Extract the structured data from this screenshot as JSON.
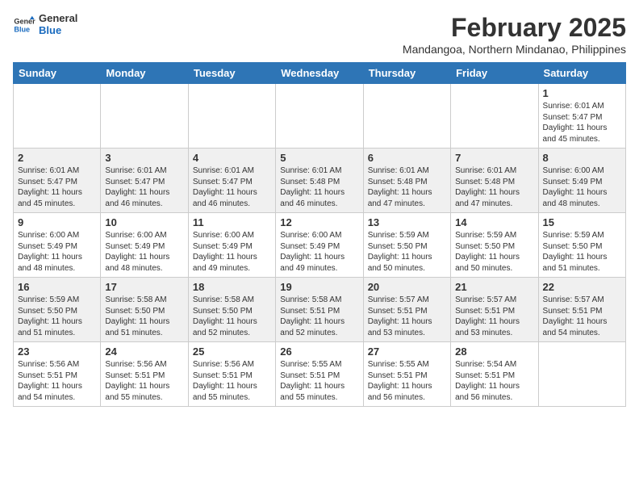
{
  "header": {
    "logo_line1": "General",
    "logo_line2": "Blue",
    "month_year": "February 2025",
    "location": "Mandangoa, Northern Mindanao, Philippines"
  },
  "days_of_week": [
    "Sunday",
    "Monday",
    "Tuesday",
    "Wednesday",
    "Thursday",
    "Friday",
    "Saturday"
  ],
  "weeks": [
    [
      {
        "day": "",
        "info": ""
      },
      {
        "day": "",
        "info": ""
      },
      {
        "day": "",
        "info": ""
      },
      {
        "day": "",
        "info": ""
      },
      {
        "day": "",
        "info": ""
      },
      {
        "day": "",
        "info": ""
      },
      {
        "day": "1",
        "info": "Sunrise: 6:01 AM\nSunset: 5:47 PM\nDaylight: 11 hours and 45 minutes."
      }
    ],
    [
      {
        "day": "2",
        "info": "Sunrise: 6:01 AM\nSunset: 5:47 PM\nDaylight: 11 hours and 45 minutes."
      },
      {
        "day": "3",
        "info": "Sunrise: 6:01 AM\nSunset: 5:47 PM\nDaylight: 11 hours and 46 minutes."
      },
      {
        "day": "4",
        "info": "Sunrise: 6:01 AM\nSunset: 5:47 PM\nDaylight: 11 hours and 46 minutes."
      },
      {
        "day": "5",
        "info": "Sunrise: 6:01 AM\nSunset: 5:48 PM\nDaylight: 11 hours and 46 minutes."
      },
      {
        "day": "6",
        "info": "Sunrise: 6:01 AM\nSunset: 5:48 PM\nDaylight: 11 hours and 47 minutes."
      },
      {
        "day": "7",
        "info": "Sunrise: 6:01 AM\nSunset: 5:48 PM\nDaylight: 11 hours and 47 minutes."
      },
      {
        "day": "8",
        "info": "Sunrise: 6:00 AM\nSunset: 5:49 PM\nDaylight: 11 hours and 48 minutes."
      }
    ],
    [
      {
        "day": "9",
        "info": "Sunrise: 6:00 AM\nSunset: 5:49 PM\nDaylight: 11 hours and 48 minutes."
      },
      {
        "day": "10",
        "info": "Sunrise: 6:00 AM\nSunset: 5:49 PM\nDaylight: 11 hours and 48 minutes."
      },
      {
        "day": "11",
        "info": "Sunrise: 6:00 AM\nSunset: 5:49 PM\nDaylight: 11 hours and 49 minutes."
      },
      {
        "day": "12",
        "info": "Sunrise: 6:00 AM\nSunset: 5:49 PM\nDaylight: 11 hours and 49 minutes."
      },
      {
        "day": "13",
        "info": "Sunrise: 5:59 AM\nSunset: 5:50 PM\nDaylight: 11 hours and 50 minutes."
      },
      {
        "day": "14",
        "info": "Sunrise: 5:59 AM\nSunset: 5:50 PM\nDaylight: 11 hours and 50 minutes."
      },
      {
        "day": "15",
        "info": "Sunrise: 5:59 AM\nSunset: 5:50 PM\nDaylight: 11 hours and 51 minutes."
      }
    ],
    [
      {
        "day": "16",
        "info": "Sunrise: 5:59 AM\nSunset: 5:50 PM\nDaylight: 11 hours and 51 minutes."
      },
      {
        "day": "17",
        "info": "Sunrise: 5:58 AM\nSunset: 5:50 PM\nDaylight: 11 hours and 51 minutes."
      },
      {
        "day": "18",
        "info": "Sunrise: 5:58 AM\nSunset: 5:50 PM\nDaylight: 11 hours and 52 minutes."
      },
      {
        "day": "19",
        "info": "Sunrise: 5:58 AM\nSunset: 5:51 PM\nDaylight: 11 hours and 52 minutes."
      },
      {
        "day": "20",
        "info": "Sunrise: 5:57 AM\nSunset: 5:51 PM\nDaylight: 11 hours and 53 minutes."
      },
      {
        "day": "21",
        "info": "Sunrise: 5:57 AM\nSunset: 5:51 PM\nDaylight: 11 hours and 53 minutes."
      },
      {
        "day": "22",
        "info": "Sunrise: 5:57 AM\nSunset: 5:51 PM\nDaylight: 11 hours and 54 minutes."
      }
    ],
    [
      {
        "day": "23",
        "info": "Sunrise: 5:56 AM\nSunset: 5:51 PM\nDaylight: 11 hours and 54 minutes."
      },
      {
        "day": "24",
        "info": "Sunrise: 5:56 AM\nSunset: 5:51 PM\nDaylight: 11 hours and 55 minutes."
      },
      {
        "day": "25",
        "info": "Sunrise: 5:56 AM\nSunset: 5:51 PM\nDaylight: 11 hours and 55 minutes."
      },
      {
        "day": "26",
        "info": "Sunrise: 5:55 AM\nSunset: 5:51 PM\nDaylight: 11 hours and 55 minutes."
      },
      {
        "day": "27",
        "info": "Sunrise: 5:55 AM\nSunset: 5:51 PM\nDaylight: 11 hours and 56 minutes."
      },
      {
        "day": "28",
        "info": "Sunrise: 5:54 AM\nSunset: 5:51 PM\nDaylight: 11 hours and 56 minutes."
      },
      {
        "day": "",
        "info": ""
      }
    ]
  ]
}
